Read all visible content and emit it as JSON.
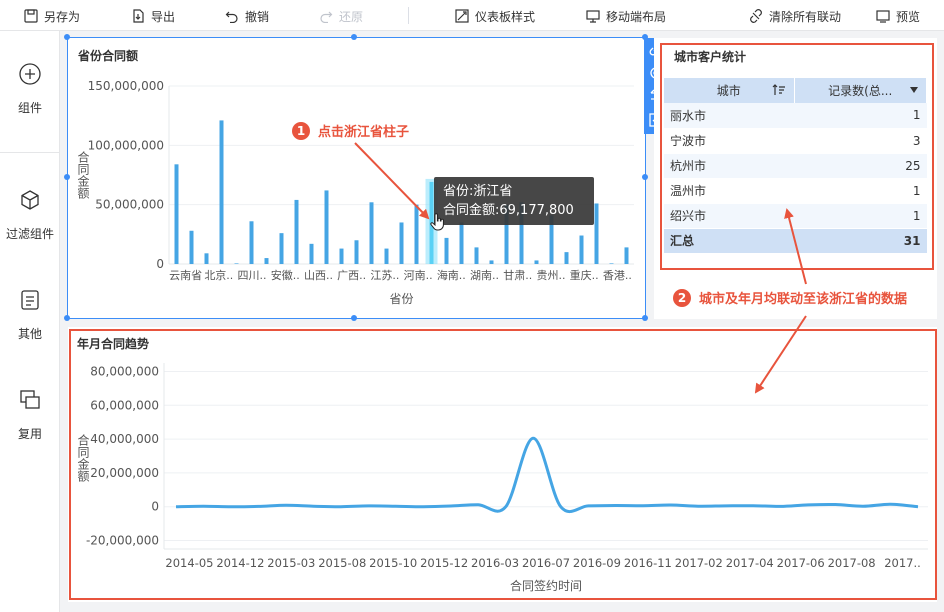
{
  "toolbar": {
    "save_as": "另存为",
    "export": "导出",
    "undo": "撤销",
    "redo": "还原",
    "dashboard_style": "仪表板样式",
    "mobile_layout": "移动端布局",
    "clear_links": "清除所有联动",
    "preview": "预览"
  },
  "sidebar": {
    "items": [
      {
        "label": "组件",
        "icon": "plus-circle-icon"
      },
      {
        "label": "过滤组件",
        "icon": "cube-icon"
      },
      {
        "label": "其他",
        "icon": "document-icon"
      },
      {
        "label": "复用",
        "icon": "copy-icon"
      }
    ]
  },
  "province_widget": {
    "title": "省份合同额",
    "tooltip_province": "省份:浙江省",
    "tooltip_amount": "合同金额:69,177,800"
  },
  "city_widget": {
    "title": "城市客户统计",
    "col_city": "城市",
    "col_count": "记录数(总...",
    "rows": [
      {
        "city": "丽水市",
        "count": "1"
      },
      {
        "city": "宁波市",
        "count": "3"
      },
      {
        "city": "杭州市",
        "count": "25"
      },
      {
        "city": "温州市",
        "count": "1"
      },
      {
        "city": "绍兴市",
        "count": "1"
      }
    ],
    "total_label": "汇总",
    "total_value": "31"
  },
  "trend_widget": {
    "title": "年月合同趋势"
  },
  "annotations": {
    "step1_num": "1",
    "step1_text": "点击浙江省柱子",
    "step2_num": "2",
    "step2_text": "城市及年月均联动至该浙江省的数据"
  },
  "colors": {
    "bar": "#45a5e4",
    "highlight": "#5ad1f5",
    "accent": "#3c8df7",
    "annotation": "#e8543d"
  },
  "chart_data": [
    {
      "type": "bar",
      "title": "省份合同额",
      "xlabel": "省份",
      "ylabel": "合同金额",
      "ylim": [
        0,
        150000000
      ],
      "yticks": [
        "150,000,000",
        "100,000,000",
        "50,000,000",
        "0"
      ],
      "ytick_values": [
        150000000,
        100000000,
        50000000,
        0
      ],
      "category_labels": [
        "云南省",
        "北京..",
        "四川..",
        "安徽..",
        "山西..",
        "广西..",
        "江苏..",
        "河南..",
        "海南..",
        "湖南..",
        "甘肃..",
        "贵州..",
        "重庆..",
        "香港.."
      ],
      "values": [
        84000000,
        28000000,
        9000000,
        121000000,
        500000,
        36000000,
        5000000,
        26000000,
        54000000,
        17000000,
        62000000,
        13000000,
        20000000,
        52000000,
        13000000,
        35000000,
        50000000,
        69177800,
        22000000,
        35000000,
        14000000,
        3000000,
        50000000,
        52000000,
        3000000,
        41000000,
        10000000,
        24000000,
        51000000,
        500000,
        14000000
      ],
      "highlight_index": 17
    },
    {
      "type": "line",
      "title": "年月合同趋势",
      "xlabel": "合同签约时间",
      "ylabel": "合同金额",
      "ylim": [
        -25000000,
        85000000
      ],
      "yticks": [
        "80,000,000",
        "60,000,000",
        "40,000,000",
        "20,000,000",
        "0",
        "-20,000,000"
      ],
      "ytick_values": [
        80000000,
        60000000,
        40000000,
        20000000,
        0,
        -20000000
      ],
      "xticks": [
        "2014-05",
        "2014-12",
        "2015-03",
        "2015-08",
        "2015-10",
        "2015-12",
        "2016-03",
        "2016-07",
        "2016-09",
        "2016-11",
        "2017-02",
        "2017-04",
        "2017-06",
        "2017-08",
        "2017.."
      ],
      "values": [
        0,
        300000,
        0,
        200000,
        900000,
        300000,
        0,
        500000,
        300000,
        0,
        400000,
        1200000,
        0,
        40500000,
        0,
        500000,
        700000,
        600000,
        1000000,
        300000,
        500000,
        600000,
        200000,
        1100000,
        1300000,
        300000,
        1500000,
        0
      ]
    }
  ]
}
